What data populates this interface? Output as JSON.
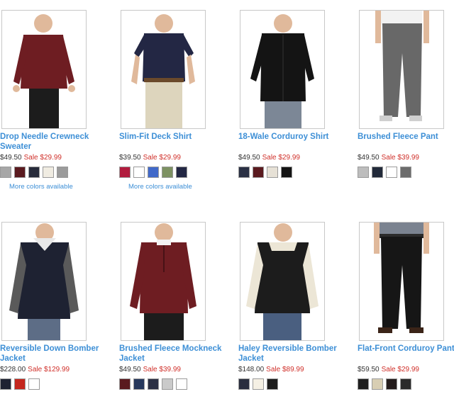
{
  "products": [
    {
      "name": "Drop Needle Crewneck Sweater",
      "orig": "$49.50",
      "sale": "Sale $29.99",
      "swatches": [
        "#a7a7a7",
        "#5a1a1f",
        "#272b3a",
        "#f0ece2",
        "#9b9b9b"
      ],
      "more": "More colors available"
    },
    {
      "name": "Slim-Fit Deck Shirt",
      "orig": "$39.50",
      "sale": "Sale $29.99",
      "swatches": [
        "#b21c3e",
        "#ffffff",
        "#4169c9",
        "#7d9162",
        "#232744"
      ],
      "more": "More colors available"
    },
    {
      "name": "18-Wale Corduroy Shirt",
      "orig": "$49.50",
      "sale": "Sale $29.99",
      "swatches": [
        "#2a3044",
        "#5a1a1f",
        "#e6e1d6",
        "#141414"
      ],
      "more": ""
    },
    {
      "name": "Brushed Fleece Pant",
      "orig": "$49.50",
      "sale": "Sale $39.99",
      "swatches": [
        "#bdbdbd",
        "#222a3a",
        "#ffffff",
        "#6c6c6c"
      ],
      "more": ""
    },
    {
      "name": "Reversible Down Bomber Jacket",
      "orig": "$228.00",
      "sale": "Sale $129.99",
      "swatches": [
        "#1e2232",
        "#c4261d",
        "#ffffff"
      ],
      "more": ""
    },
    {
      "name": "Brushed Fleece Mockneck Jacket",
      "orig": "$49.50",
      "sale": "Sale $39.99",
      "swatches": [
        "#5a1a1f",
        "#26385c",
        "#2b3044",
        "#cacaca",
        "#ffffff"
      ],
      "more": ""
    },
    {
      "name": "Haley Reversible Bomber Jacket",
      "orig": "$148.00",
      "sale": "Sale $89.99",
      "swatches": [
        "#2a2e3e",
        "#f5f0e4",
        "#1c1c1c"
      ],
      "more": ""
    },
    {
      "name": "Flat-Front Corduroy Pant",
      "orig": "$59.50",
      "sale": "Sale $29.99",
      "swatches": [
        "#1f1f1f",
        "#d8ceb3",
        "#241c1c",
        "#2b2b2b"
      ],
      "more": ""
    }
  ]
}
